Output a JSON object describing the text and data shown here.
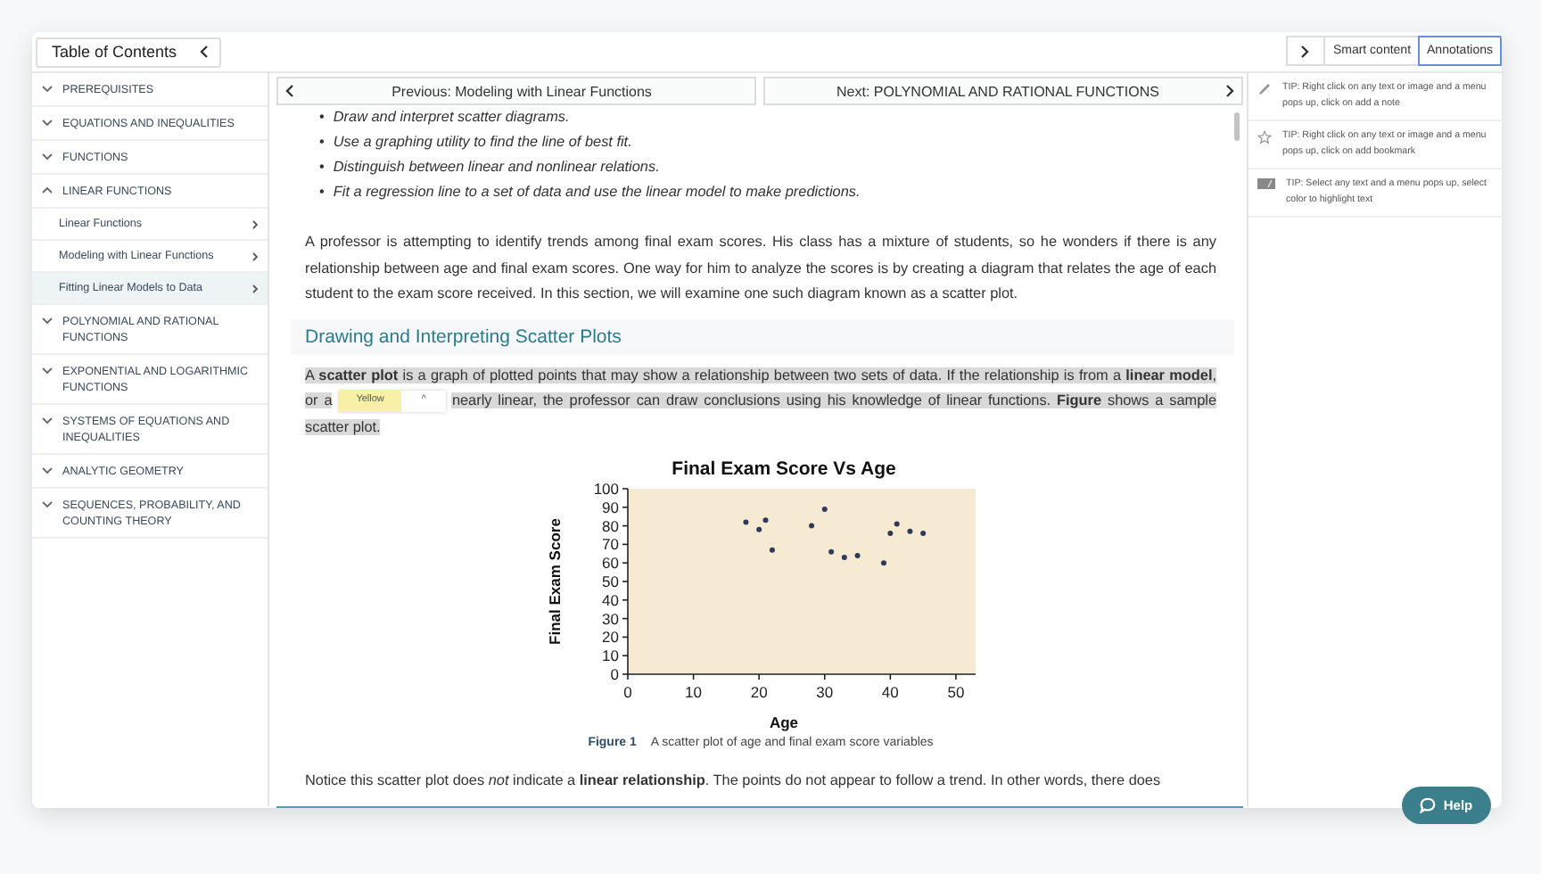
{
  "toc": {
    "title": "Table of Contents"
  },
  "sidebar": {
    "items": [
      {
        "label": "PREREQUISITES",
        "expanded": false
      },
      {
        "label": "EQUATIONS AND INEQUALITIES",
        "expanded": false
      },
      {
        "label": "FUNCTIONS",
        "expanded": false
      },
      {
        "label": "LINEAR FUNCTIONS",
        "expanded": true,
        "children": [
          {
            "label": "Linear Functions",
            "selected": false
          },
          {
            "label": "Modeling with Linear Functions",
            "selected": false
          },
          {
            "label": "Fitting Linear Models to Data",
            "selected": true
          }
        ]
      },
      {
        "label": "POLYNOMIAL AND RATIONAL FUNCTIONS",
        "expanded": false
      },
      {
        "label": "EXPONENTIAL AND LOGARITHMIC FUNCTIONS",
        "expanded": false
      },
      {
        "label": "SYSTEMS OF EQUATIONS AND INEQUALITIES",
        "expanded": false
      },
      {
        "label": "ANALYTIC GEOMETRY",
        "expanded": false
      },
      {
        "label": "SEQUENCES, PROBABILITY, AND COUNTING THEORY",
        "expanded": false
      }
    ]
  },
  "nav": {
    "previous": "Previous: Modeling with Linear Functions",
    "next": "Next: POLYNOMIAL AND RATIONAL FUNCTIONS"
  },
  "content": {
    "bullet": "•",
    "objectives": [
      "Draw and interpret scatter diagrams.",
      "Use a graphing utility to find the line of best fit.",
      "Distinguish between linear and nonlinear relations.",
      "Fit a regression line to a set of data and use the linear model to make predictions."
    ],
    "intro": "A professor is attempting to identify trends among final exam scores. His class has a mixture of students, so he wonders if there is any relationship between age and final exam scores. One way for him to analyze the scores is by creating a diagram that relates the age of each student to the exam score received. In this section, we will examine one such diagram known as a scatter plot.",
    "section_heading": "Drawing and Interpreting Scatter Plots",
    "selected_paragraph": {
      "before": "A **scatter plot** is a graph of plotted points that may show a relationship between two sets of data. If the relationship is from a **linear model**, or a",
      "after": "nearly linear, the professor can draw conclusions using his knowledge of linear functions. **Figure** shows a sample scatter plot."
    },
    "highlight_popup": {
      "label": "Yellow",
      "caret": "^"
    },
    "figure": {
      "label": "Figure 1",
      "caption": "A scatter plot of age and final exam score variables",
      "chart_data": {
        "type": "scatter",
        "title": "Final Exam Score Vs Age",
        "xlabel": "Age",
        "ylabel": "Final Exam Score",
        "xlim": [
          0,
          53
        ],
        "ylim": [
          0,
          100
        ],
        "xticks": [
          0,
          10,
          20,
          30,
          40,
          50
        ],
        "yticks": [
          0,
          10,
          20,
          30,
          40,
          50,
          60,
          70,
          80,
          90,
          100
        ],
        "x": [
          18,
          20,
          21,
          22,
          28,
          30,
          31,
          33,
          35,
          39,
          40,
          41,
          43,
          45
        ],
        "values": [
          82,
          78,
          83,
          67,
          80,
          89,
          66,
          63,
          64,
          60,
          76,
          81,
          77,
          76
        ]
      }
    },
    "closing": "Notice this scatter plot does *not* indicate a **linear relationship**. The points do not appear to follow a trend. In other words, there does"
  },
  "right_panel": {
    "tabs": [
      {
        "label": "Smart content",
        "selected": false
      },
      {
        "label": "Annotations",
        "selected": true
      }
    ],
    "tips": [
      {
        "kind": "note",
        "text": "TIP: Right click on any text or image and a menu pops up, click on  add a note"
      },
      {
        "kind": "bookmark",
        "text": "TIP: Right click on any text or image and a menu pops up, click on  add bookmark"
      },
      {
        "kind": "highlight",
        "text": "TIP: Select any text and a menu pops up, select color to  highlight text"
      }
    ]
  },
  "help": {
    "label": "Help"
  }
}
